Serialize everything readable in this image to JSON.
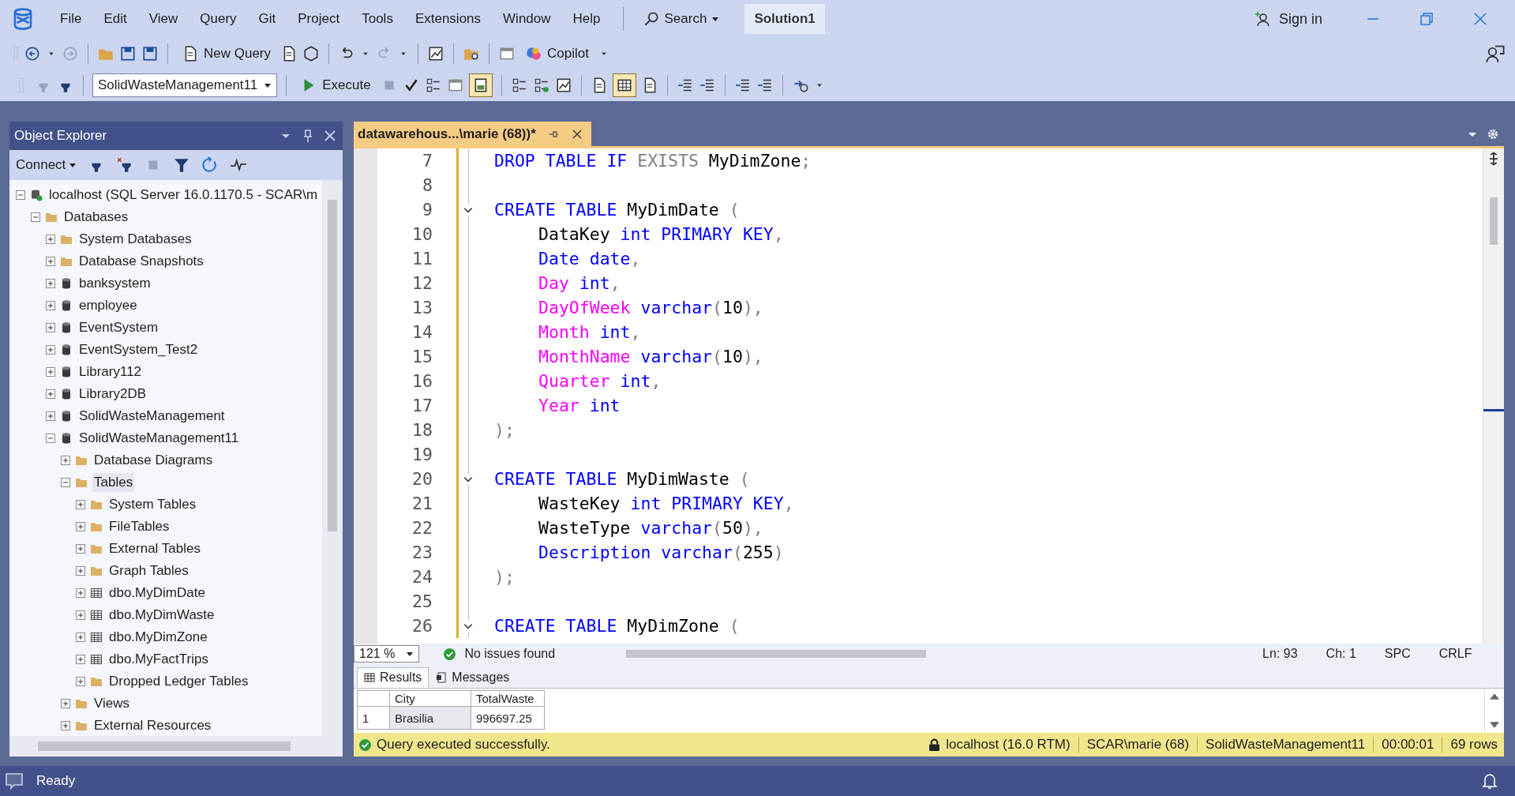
{
  "window": {
    "menu": [
      "File",
      "Edit",
      "View",
      "Query",
      "Git",
      "Project",
      "Tools",
      "Extensions",
      "Window",
      "Help"
    ],
    "search": "Search",
    "solution": "Solution1",
    "sign_in": "Sign in"
  },
  "toolbar": {
    "new_query": "New Query",
    "copilot": "Copilot",
    "database": "SolidWasteManagement11",
    "execute": "Execute",
    "results_pane_on": true,
    "results_to_grid_on": true
  },
  "object_explorer": {
    "title": "Object Explorer",
    "connect": "Connect",
    "tree": [
      {
        "label": "localhost (SQL Server 16.0.1170.5 - SCAR\\m",
        "kind": "server",
        "expanded": true,
        "selected": false,
        "children": [
          {
            "label": "Databases",
            "kind": "folder",
            "expanded": true,
            "selected": false,
            "children": [
              {
                "label": "System Databases",
                "kind": "folder",
                "expanded": false,
                "selected": false
              },
              {
                "label": "Database Snapshots",
                "kind": "folder",
                "expanded": false,
                "selected": false
              },
              {
                "label": "banksystem",
                "kind": "database",
                "expanded": false,
                "selected": false
              },
              {
                "label": "employee",
                "kind": "database",
                "expanded": false,
                "selected": false
              },
              {
                "label": "EventSystem",
                "kind": "database",
                "expanded": false,
                "selected": false
              },
              {
                "label": "EventSystem_Test2",
                "kind": "database",
                "expanded": false,
                "selected": false
              },
              {
                "label": "Library112",
                "kind": "database",
                "expanded": false,
                "selected": false
              },
              {
                "label": "Library2DB",
                "kind": "database",
                "expanded": false,
                "selected": false
              },
              {
                "label": "SolidWasteManagement",
                "kind": "database",
                "expanded": false,
                "selected": false
              },
              {
                "label": "SolidWasteManagement11",
                "kind": "database",
                "expanded": true,
                "selected": false,
                "children": [
                  {
                    "label": "Database Diagrams",
                    "kind": "folder",
                    "expanded": false,
                    "selected": false
                  },
                  {
                    "label": "Tables",
                    "kind": "folder",
                    "expanded": true,
                    "selected": true,
                    "children": [
                      {
                        "label": "System Tables",
                        "kind": "folder",
                        "expanded": false,
                        "selected": false
                      },
                      {
                        "label": "FileTables",
                        "kind": "folder",
                        "expanded": false,
                        "selected": false
                      },
                      {
                        "label": "External Tables",
                        "kind": "folder",
                        "expanded": false,
                        "selected": false
                      },
                      {
                        "label": "Graph Tables",
                        "kind": "folder",
                        "expanded": false,
                        "selected": false
                      },
                      {
                        "label": "dbo.MyDimDate",
                        "kind": "table",
                        "expanded": false,
                        "selected": false
                      },
                      {
                        "label": "dbo.MyDimWaste",
                        "kind": "table",
                        "expanded": false,
                        "selected": false
                      },
                      {
                        "label": "dbo.MyDimZone",
                        "kind": "table",
                        "expanded": false,
                        "selected": false
                      },
                      {
                        "label": "dbo.MyFactTrips",
                        "kind": "table",
                        "expanded": false,
                        "selected": false
                      },
                      {
                        "label": "Dropped Ledger Tables",
                        "kind": "folder",
                        "expanded": false,
                        "selected": false
                      }
                    ]
                  },
                  {
                    "label": "Views",
                    "kind": "folder",
                    "expanded": false,
                    "selected": false
                  },
                  {
                    "label": "External Resources",
                    "kind": "folder",
                    "expanded": false,
                    "selected": false
                  }
                ]
              }
            ]
          }
        ]
      }
    ]
  },
  "editor": {
    "tab": "datawarehous...\\marie (68))*",
    "lines": [
      {
        "number": "7",
        "fold": false,
        "indented": false,
        "segments": [
          {
            "kind": "keyword",
            "text": "DROP TABLE IF "
          },
          {
            "kind": "function",
            "text": "EXISTS "
          },
          {
            "kind": "name",
            "text": "MyDimZone"
          },
          {
            "kind": "punctuation",
            "text": ";"
          }
        ]
      },
      {
        "number": "8",
        "fold": false
      },
      {
        "number": "9",
        "fold": true,
        "indented": false,
        "segments": [
          {
            "kind": "keyword",
            "text": "CREATE TABLE "
          },
          {
            "kind": "name",
            "text": "MyDimDate "
          },
          {
            "kind": "punctuation",
            "text": "("
          }
        ]
      },
      {
        "number": "10",
        "fold": false,
        "indented": true,
        "segments": [
          {
            "kind": "name",
            "text": "DataKey "
          },
          {
            "kind": "keyword",
            "text": "int PRIMARY KEY"
          },
          {
            "kind": "punctuation",
            "text": ","
          }
        ]
      },
      {
        "number": "11",
        "fold": false,
        "indented": true,
        "segments": [
          {
            "kind": "keyword",
            "text": "Date date"
          },
          {
            "kind": "punctuation",
            "text": ","
          }
        ]
      },
      {
        "number": "12",
        "fold": false,
        "indented": true,
        "segments": [
          {
            "kind": "column",
            "text": "Day "
          },
          {
            "kind": "keyword",
            "text": "int"
          },
          {
            "kind": "punctuation",
            "text": ","
          }
        ]
      },
      {
        "number": "13",
        "fold": false,
        "indented": true,
        "segments": [
          {
            "kind": "column",
            "text": "DayOfWeek "
          },
          {
            "kind": "keyword",
            "text": "varchar"
          },
          {
            "kind": "punctuation",
            "text": "("
          },
          {
            "kind": "name",
            "text": "10"
          },
          {
            "kind": "punctuation",
            "text": "),"
          }
        ]
      },
      {
        "number": "14",
        "fold": false,
        "indented": true,
        "segments": [
          {
            "kind": "column",
            "text": "Month "
          },
          {
            "kind": "keyword",
            "text": "int"
          },
          {
            "kind": "punctuation",
            "text": ","
          }
        ]
      },
      {
        "number": "15",
        "fold": false,
        "indented": true,
        "segments": [
          {
            "kind": "column",
            "text": "MonthName "
          },
          {
            "kind": "keyword",
            "text": "varchar"
          },
          {
            "kind": "punctuation",
            "text": "("
          },
          {
            "kind": "name",
            "text": "10"
          },
          {
            "kind": "punctuation",
            "text": "),"
          }
        ]
      },
      {
        "number": "16",
        "fold": false,
        "indented": true,
        "segments": [
          {
            "kind": "column",
            "text": "Quarter "
          },
          {
            "kind": "keyword",
            "text": "int"
          },
          {
            "kind": "punctuation",
            "text": ","
          }
        ]
      },
      {
        "number": "17",
        "fold": false,
        "indented": true,
        "segments": [
          {
            "kind": "column",
            "text": "Year "
          },
          {
            "kind": "keyword",
            "text": "int"
          }
        ]
      },
      {
        "number": "18",
        "fold": false,
        "indented": false,
        "segments": [
          {
            "kind": "punctuation",
            "text": ");"
          }
        ]
      },
      {
        "number": "19",
        "fold": false
      },
      {
        "number": "20",
        "fold": true,
        "indented": false,
        "segments": [
          {
            "kind": "keyword",
            "text": "CREATE TABLE "
          },
          {
            "kind": "name",
            "text": "MyDimWaste "
          },
          {
            "kind": "punctuation",
            "text": "("
          }
        ]
      },
      {
        "number": "21",
        "fold": false,
        "indented": true,
        "segments": [
          {
            "kind": "name",
            "text": "WasteKey "
          },
          {
            "kind": "keyword",
            "text": "int PRIMARY KEY"
          },
          {
            "kind": "punctuation",
            "text": ","
          }
        ]
      },
      {
        "number": "22",
        "fold": false,
        "indented": true,
        "segments": [
          {
            "kind": "name",
            "text": "WasteType "
          },
          {
            "kind": "keyword",
            "text": "varchar"
          },
          {
            "kind": "punctuation",
            "text": "("
          },
          {
            "kind": "name",
            "text": "50"
          },
          {
            "kind": "punctuation",
            "text": "),"
          }
        ]
      },
      {
        "number": "23",
        "fold": false,
        "indented": true,
        "segments": [
          {
            "kind": "keyword",
            "text": "Description varchar"
          },
          {
            "kind": "punctuation",
            "text": "("
          },
          {
            "kind": "name",
            "text": "255"
          },
          {
            "kind": "punctuation",
            "text": ")"
          }
        ]
      },
      {
        "number": "24",
        "fold": false,
        "indented": false,
        "segments": [
          {
            "kind": "punctuation",
            "text": ");"
          }
        ]
      },
      {
        "number": "25",
        "fold": false
      },
      {
        "number": "26",
        "fold": true,
        "indented": false,
        "segments": [
          {
            "kind": "keyword",
            "text": "CREATE TABLE "
          },
          {
            "kind": "name",
            "text": "MyDimZone "
          },
          {
            "kind": "punctuation",
            "text": "("
          }
        ]
      }
    ],
    "status": {
      "zoom": "121 %",
      "issues": "No issues found",
      "ln": "Ln: 93",
      "ch": "Ch: 1",
      "spacing": "SPC",
      "eol": "CRLF"
    }
  },
  "results": {
    "tabs": [
      {
        "label": "Results",
        "selected": true
      },
      {
        "label": "Messages",
        "selected": false
      }
    ],
    "columns": [
      "City",
      "TotalWaste"
    ],
    "rows": [
      {
        "number": "1",
        "cells": [
          "Brasilia",
          "996697.25"
        ]
      }
    ]
  },
  "query_status": {
    "message": "Query executed successfully.",
    "server": "localhost (16.0 RTM)",
    "user": "SCAR\\marie (68)",
    "database": "SolidWasteManagement11",
    "elapsed": "00:00:01",
    "rows": "69 rows"
  },
  "status_bar": "Ready"
}
